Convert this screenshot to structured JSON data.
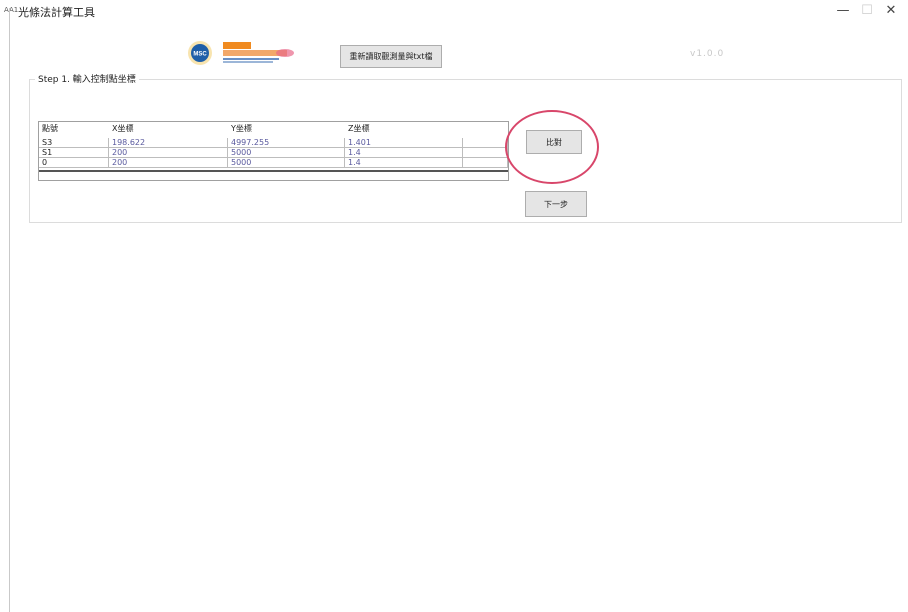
{
  "window": {
    "icon_label": "AA1",
    "title": "光條法計算工具",
    "min_symbol": "—",
    "max_symbol": "☐",
    "close_symbol": "✕"
  },
  "header": {
    "logo_badge": "MSC",
    "reload_button": "重新讀取觀測量與txt檔",
    "version": "v1.0.0"
  },
  "step1": {
    "legend": "Step 1. 輸入控制點坐標",
    "columns": [
      "點號",
      "X坐標",
      "Y坐標",
      "Z坐標"
    ],
    "rows": [
      [
        "S3",
        "198.622",
        "4997.255",
        "1.401"
      ],
      [
        "S1",
        "200",
        "5000",
        "1.4"
      ],
      [
        "0",
        "200",
        "5000",
        "1.4"
      ]
    ],
    "compare_button": "比對",
    "next_button": "下一步"
  },
  "colors": {
    "highlight_ring": "#d8466a",
    "button_bg": "#e5e5e5",
    "value_text": "#5a5a9e",
    "logo_blue": "#1f5fa8",
    "logo_orange": "#f08a1f"
  }
}
